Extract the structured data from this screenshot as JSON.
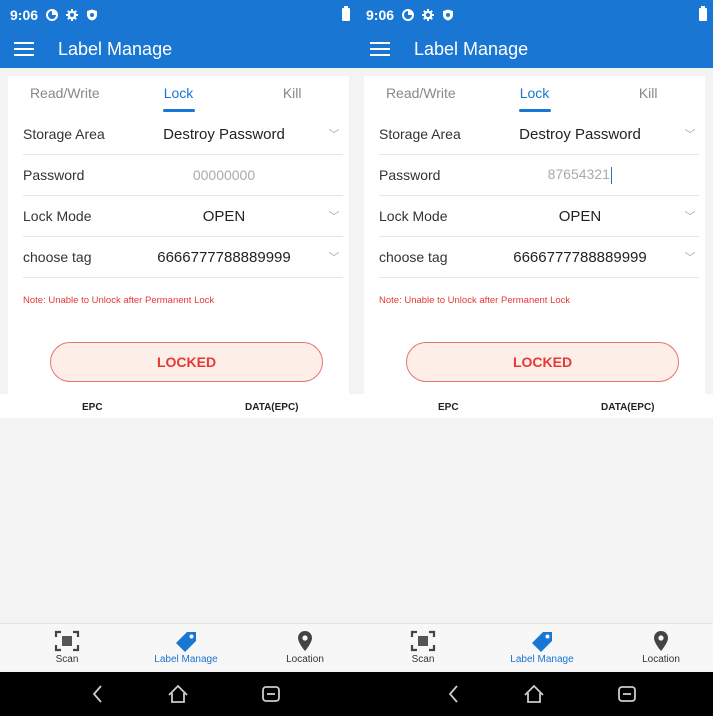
{
  "screens": [
    {
      "status": {
        "time": "9:06"
      },
      "appbar": {
        "title": "Label Manage"
      },
      "tabs": [
        {
          "label": "Read/Write"
        },
        {
          "label": "Lock"
        },
        {
          "label": "Kill"
        }
      ],
      "form": {
        "storage_area": {
          "label": "Storage Area",
          "value": "Destroy Password"
        },
        "password": {
          "label": "Password",
          "value": "",
          "placeholder": "00000000"
        },
        "lock_mode": {
          "label": "Lock Mode",
          "value": "OPEN"
        },
        "choose_tag": {
          "label": "choose tag",
          "value": "6666777788889999"
        }
      },
      "note": "Note: Unable to Unlock after Permanent Lock",
      "locked_button": "LOCKED",
      "table": {
        "col1": "EPC",
        "col2": "DATA(EPC)"
      },
      "bottom_nav": [
        {
          "label": "Scan",
          "icon": "scan-icon"
        },
        {
          "label": "Label Manage",
          "icon": "tag-icon"
        },
        {
          "label": "Location",
          "icon": "location-pin-icon"
        }
      ]
    },
    {
      "status": {
        "time": "9:06"
      },
      "appbar": {
        "title": "Label Manage"
      },
      "tabs": [
        {
          "label": "Read/Write"
        },
        {
          "label": "Lock"
        },
        {
          "label": "Kill"
        }
      ],
      "form": {
        "storage_area": {
          "label": "Storage Area",
          "value": "Destroy Password"
        },
        "password": {
          "label": "Password",
          "value": "87654321",
          "placeholder": "00000000"
        },
        "lock_mode": {
          "label": "Lock Mode",
          "value": "OPEN"
        },
        "choose_tag": {
          "label": "choose tag",
          "value": "6666777788889999"
        }
      },
      "note": "Note: Unable to Unlock after Permanent Lock",
      "locked_button": "LOCKED",
      "table": {
        "col1": "EPC",
        "col2": "DATA(EPC)"
      },
      "bottom_nav": [
        {
          "label": "Scan",
          "icon": "scan-icon"
        },
        {
          "label": "Label Manage",
          "icon": "tag-icon"
        },
        {
          "label": "Location",
          "icon": "location-pin-icon"
        }
      ]
    }
  ],
  "colors": {
    "primary": "#1976d2",
    "danger": "#e53935",
    "locked_bg": "#fdeee8"
  },
  "active_tab_index": 1,
  "active_nav_index": 1
}
